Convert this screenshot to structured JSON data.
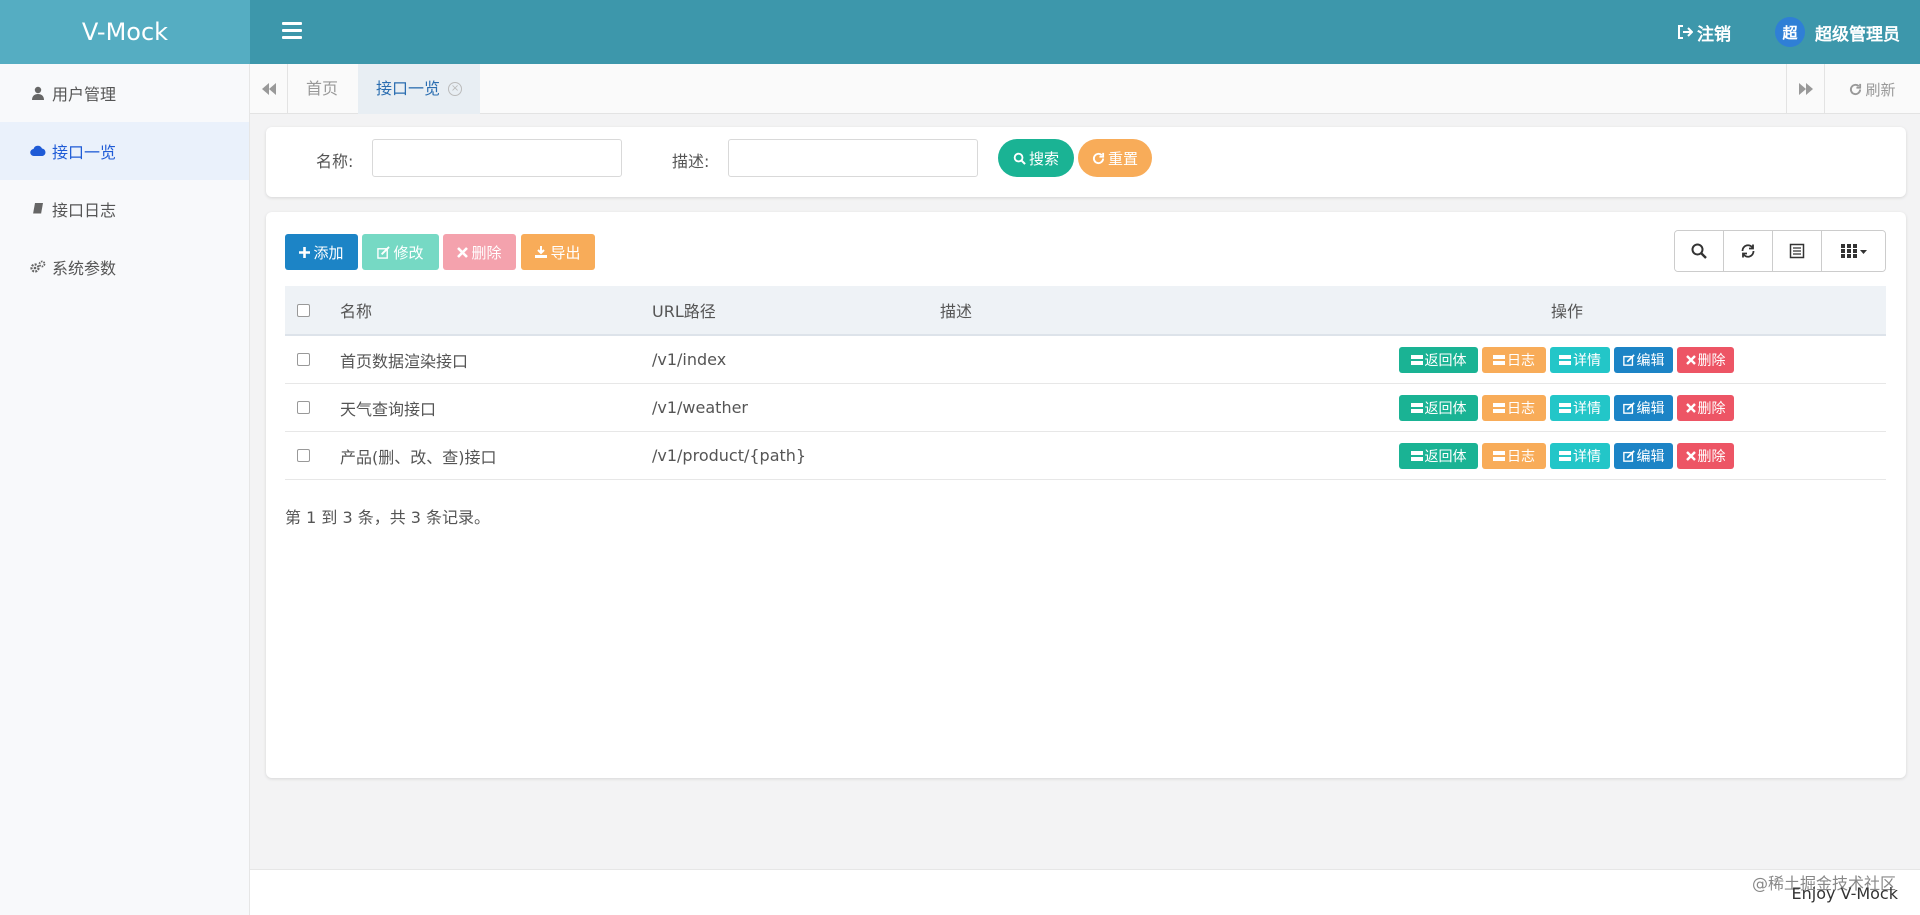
{
  "header": {
    "brand": "V-Mock",
    "logout_label": "注销",
    "user_avatar_char": "超",
    "user_name": "超级管理员"
  },
  "sidebar": {
    "items": [
      {
        "label": "用户管理",
        "icon": "user-icon"
      },
      {
        "label": "接口一览",
        "icon": "cloud-icon",
        "active": true
      },
      {
        "label": "接口日志",
        "icon": "book-icon"
      },
      {
        "label": "系统参数",
        "icon": "gears-icon"
      }
    ]
  },
  "tabs": {
    "home": "首页",
    "active": "接口一览",
    "refresh": "刷新"
  },
  "search": {
    "name_label": "名称:",
    "desc_label": "描述:",
    "search_button": "搜索",
    "reset_button": "重置"
  },
  "toolbar": {
    "add": "添加",
    "edit": "修改",
    "delete": "删除",
    "export": "导出"
  },
  "table": {
    "columns": [
      "名称",
      "URL路径",
      "描述",
      "操作"
    ],
    "rows": [
      {
        "name": "首页数据渲染接口",
        "url": "/v1/index",
        "desc": ""
      },
      {
        "name": "天气查询接口",
        "url": "/v1/weather",
        "desc": ""
      },
      {
        "name": "产品(删、改、查)接口",
        "url": "/v1/product/{path}",
        "desc": ""
      }
    ],
    "actions": [
      "返回体",
      "日志",
      "详情",
      "编辑",
      "删除"
    ]
  },
  "pagination": "第 1 到 3 条，共 3 条记录。",
  "footer": {
    "text": "Enjoy V-Mock",
    "watermark": "@稀土掘金技术社区"
  },
  "colors": {
    "header": "#3d97ab",
    "brand_bg": "#55adc2",
    "primary": "#1c84c6",
    "success": "#1ab394",
    "warning": "#f8ac59",
    "danger": "#ed5565",
    "info": "#23c6c8"
  }
}
